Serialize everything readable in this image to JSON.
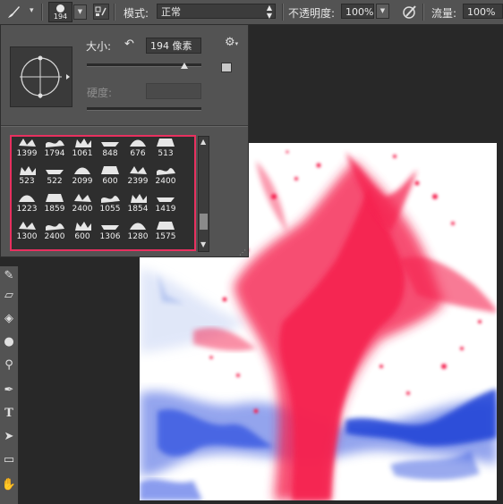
{
  "options_bar": {
    "brush_size": "194",
    "mode_label": "模式:",
    "mode_value": "正常",
    "opacity_label": "不透明度:",
    "opacity_value": "100%",
    "flow_label": "流量:",
    "flow_value": "100%"
  },
  "brush_panel": {
    "size_label": "大小:",
    "size_value": "194 像素",
    "hardness_label": "硬度:",
    "size_slider": 0.85,
    "brushes": [
      [
        "1399",
        "1794",
        "1061",
        "848",
        "676",
        "513"
      ],
      [
        "523",
        "522",
        "2099",
        "600",
        "2399",
        "2400"
      ],
      [
        "1223",
        "1859",
        "2400",
        "1055",
        "1854",
        "1419"
      ],
      [
        "1300",
        "2400",
        "600",
        "1306",
        "1280",
        "1575"
      ]
    ]
  },
  "colors": {
    "ui_gray": "#535353",
    "highlight_border": "#e8305f",
    "splash_red": "#f5214f",
    "splash_blue": "#2345d8"
  }
}
